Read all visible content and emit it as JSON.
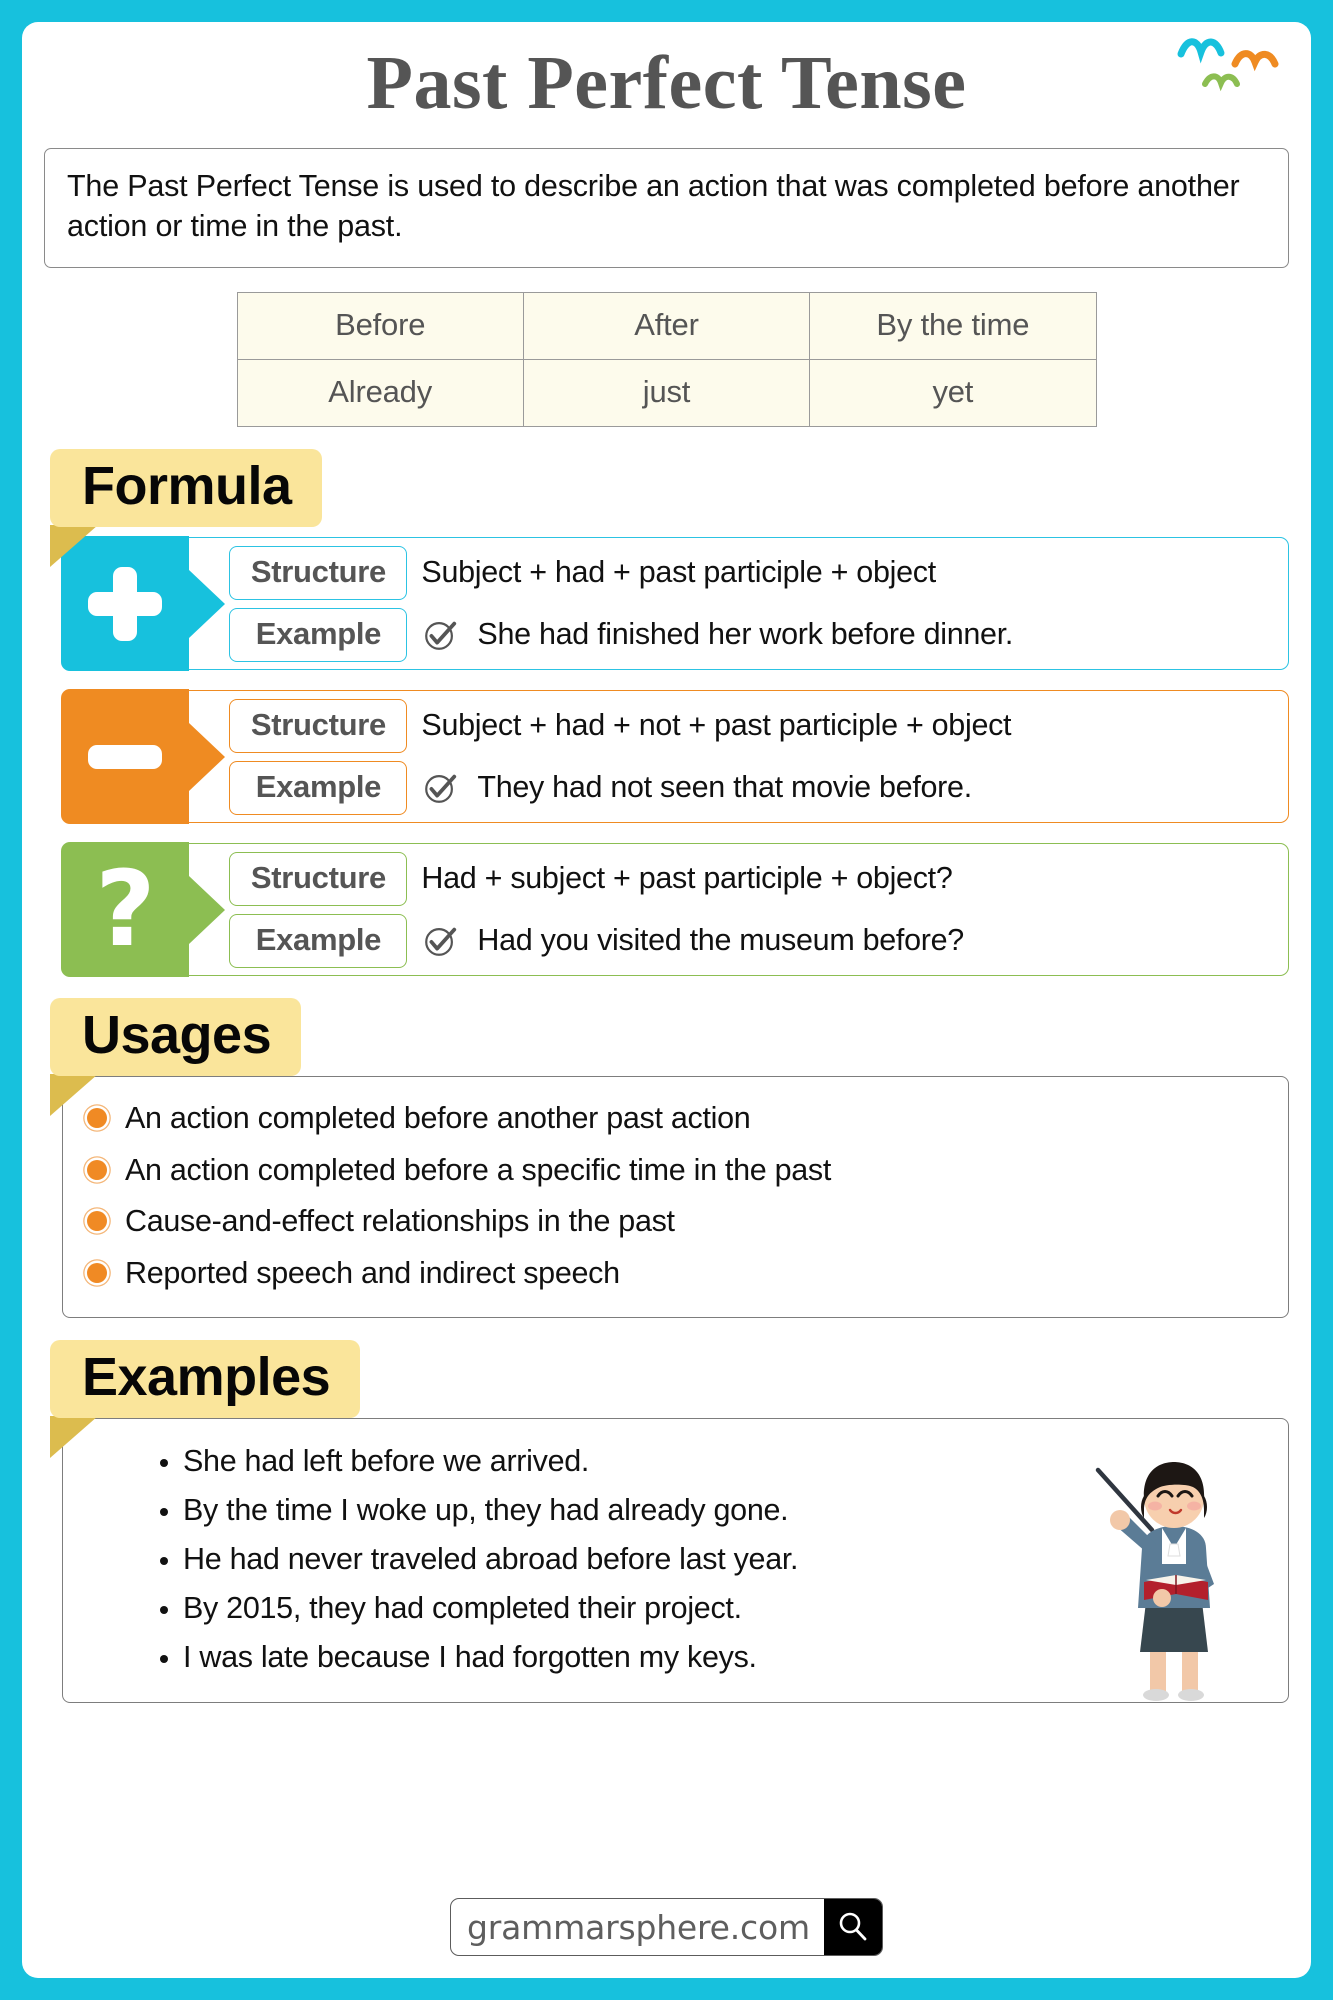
{
  "page": {
    "title": "Past Perfect Tense",
    "intro": "The Past Perfect Tense is used to describe an action that was completed before another action or time in the past.",
    "frame_color": "#17c1dd",
    "title_color": "#555555"
  },
  "keywords": {
    "rows": [
      [
        "Before",
        "After",
        "By the time"
      ],
      [
        "Already",
        "just",
        "yet"
      ]
    ],
    "cell_bg": "#fdfbec"
  },
  "formula": {
    "heading": "Formula",
    "rows": [
      {
        "sign": "plus-icon",
        "color": "#17c1dd",
        "structure_label": "Structure",
        "structure_text": "Subject + had + past participle + object",
        "example_label": "Example",
        "example_text": "She had finished her work before dinner."
      },
      {
        "sign": "minus-icon",
        "color": "#ef8b22",
        "structure_label": "Structure",
        "structure_text": "Subject + had + not + past participle + object",
        "example_label": "Example",
        "example_text": "They had not seen that movie before."
      },
      {
        "sign": "question-mark-icon",
        "color": "#8cbe52",
        "structure_label": "Structure",
        "structure_text": "Had + subject + past participle + object?",
        "example_label": "Example",
        "example_text": "Had you visited the museum before?"
      }
    ]
  },
  "usages": {
    "heading": "Usages",
    "bullet_color": "#f08a24",
    "items": [
      "An action completed before another past action",
      "An action completed before a specific time in the past",
      "Cause-and-effect relationships in the past",
      "Reported speech and indirect speech"
    ]
  },
  "examples": {
    "heading": "Examples",
    "items": [
      "She had left before we arrived.",
      "By the time I woke up, they had already gone.",
      "He had never traveled abroad before last year.",
      "By 2015, they had completed their project.",
      "I was late because I had forgotten my keys."
    ]
  },
  "footer": {
    "url": "grammarsphere.com",
    "search_icon": "magnifier-icon"
  },
  "decorations": {
    "birds": [
      "#17c1dd",
      "#ef8b22",
      "#8cbe52"
    ]
  }
}
